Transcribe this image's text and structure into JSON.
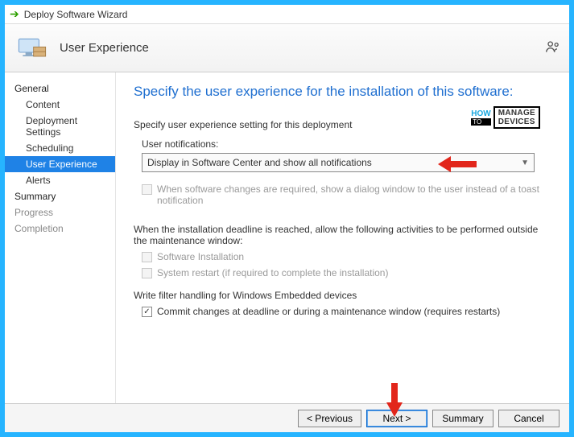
{
  "window": {
    "title": "Deploy Software Wizard"
  },
  "header": {
    "page": "User Experience"
  },
  "sidebar": {
    "items": [
      {
        "label": "General"
      },
      {
        "label": "Content"
      },
      {
        "label": "Deployment Settings"
      },
      {
        "label": "Scheduling"
      },
      {
        "label": "User Experience"
      },
      {
        "label": "Alerts"
      },
      {
        "label": "Summary"
      },
      {
        "label": "Progress"
      },
      {
        "label": "Completion"
      }
    ]
  },
  "main": {
    "heading": "Specify the user experience for the installation of this software:",
    "intro": "Specify user experience setting for this deployment",
    "user_notif_label": "User notifications:",
    "user_notif_value": "Display in Software Center and show all notifications",
    "dialog_checkbox": "When software changes are required, show a dialog window to the user instead of a toast notification",
    "deadline_text": "When the installation deadline is reached, allow the following activities to be performed outside the maintenance window:",
    "soft_install": "Software Installation",
    "sys_restart": "System restart  (if required to complete the installation)",
    "write_filter_label": "Write filter handling for Windows Embedded devices",
    "commit_checkbox": "Commit changes at deadline or during a maintenance window (requires restarts)"
  },
  "buttons": {
    "previous": "< Previous",
    "next": "Next >",
    "summary": "Summary",
    "cancel": "Cancel"
  },
  "watermark": {
    "how": "HOW",
    "to": "TO",
    "manage": "MANAGE",
    "devices": "DEVICES"
  }
}
